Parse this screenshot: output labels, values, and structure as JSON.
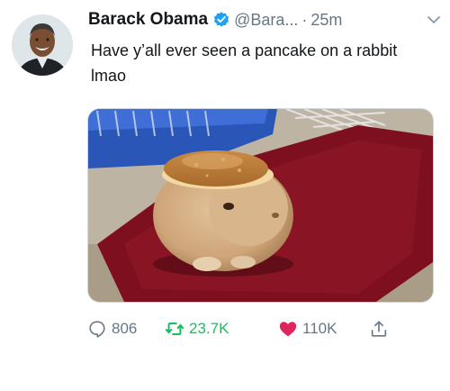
{
  "author": {
    "name": "Barack Obama",
    "handle": "@Bara...",
    "separator": "·",
    "time": "25m"
  },
  "tweet": {
    "text": "Have y’all ever seen a pancake on a rabbit lmao"
  },
  "actions": {
    "replies": "806",
    "retweets": "23.7K",
    "likes": "110K"
  },
  "icons": {
    "verified": "verified-badge-icon",
    "caret": "chevron-down-icon",
    "reply": "reply-bubble-icon",
    "retweet": "retweet-icon",
    "like": "heart-icon",
    "share": "share-icon"
  },
  "colors": {
    "verified": "#1da1f2",
    "retweet": "#17bf63",
    "like": "#e0245e",
    "muted": "#657786"
  }
}
